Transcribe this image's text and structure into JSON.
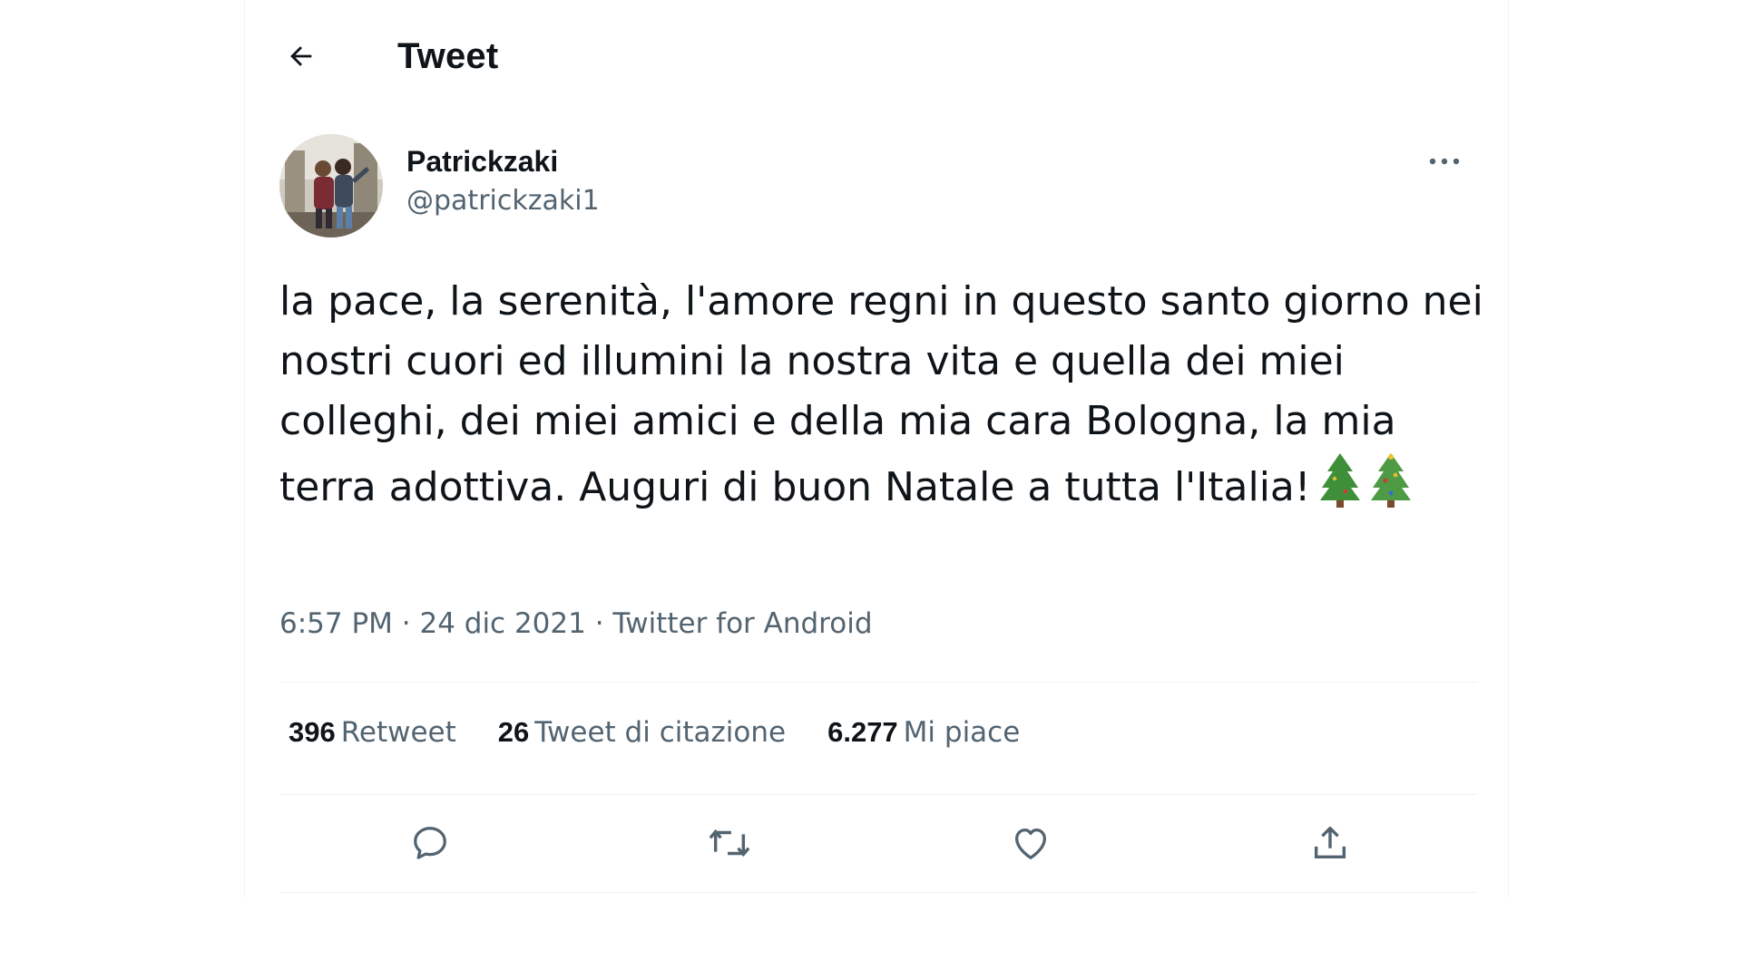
{
  "header": {
    "title": "Tweet"
  },
  "author": {
    "display_name": "Patrickzaki",
    "handle": "@patrickzaki1"
  },
  "tweet": {
    "text": "la pace, la serenità, l'amore regni in questo santo giorno nei nostri cuori ed illumini la nostra vita e quella dei miei colleghi, dei miei amici e della mia cara Bologna, la mia terra adottiva. Auguri di buon Natale a tutta l'Italia!",
    "emojis": [
      "christmas-tree",
      "christmas-tree"
    ],
    "meta": "6:57 PM · 24 dic 2021 · Twitter for Android"
  },
  "stats": {
    "retweets": {
      "count": "396",
      "label": "Retweet"
    },
    "quotes": {
      "count": "26",
      "label": "Tweet di citazione"
    },
    "likes": {
      "count": "6.277",
      "label": "Mi piace"
    }
  },
  "actions": [
    "reply-icon",
    "retweet-icon",
    "like-icon",
    "share-icon"
  ],
  "colors": {
    "text": "#0f1419",
    "secondary": "#536471",
    "divider": "#eff3f4"
  }
}
